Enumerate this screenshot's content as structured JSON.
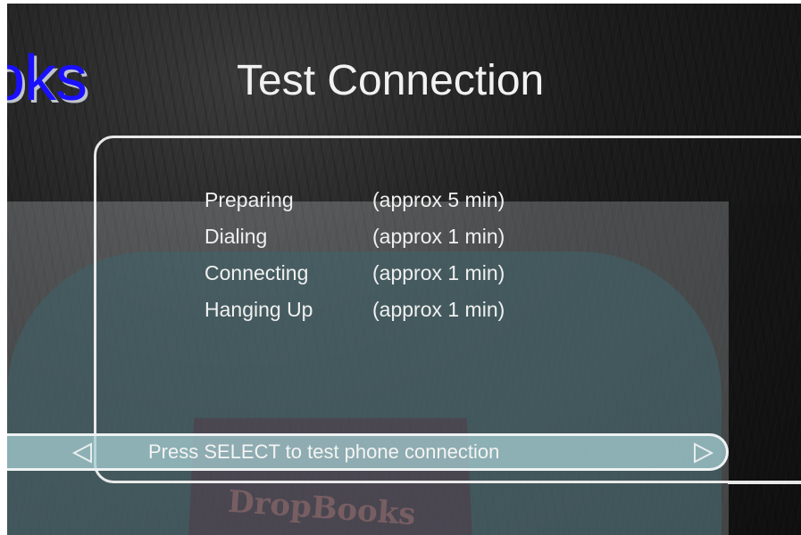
{
  "watermark": {
    "partial_text": "oks"
  },
  "header": {
    "title": "Test Connection"
  },
  "steps": [
    {
      "name": "Preparing",
      "time": "(approx 5 min)"
    },
    {
      "name": "Dialing",
      "time": "(approx 1 min)"
    },
    {
      "name": "Connecting",
      "time": "(approx 1 min)"
    },
    {
      "name": "Hanging Up",
      "time": "(approx 1 min)"
    }
  ],
  "select_bar": {
    "label": "Press SELECT to test phone connection",
    "left_icon": "left-arrow-icon",
    "right_icon": "right-arrow-icon"
  },
  "overlay": {
    "brand_text": "DropBooks"
  },
  "colors": {
    "background": "#1c1c1c",
    "text": "#f0f0f0",
    "watermark_blue": "#1a10ff",
    "bar": "#a5cdd2"
  }
}
